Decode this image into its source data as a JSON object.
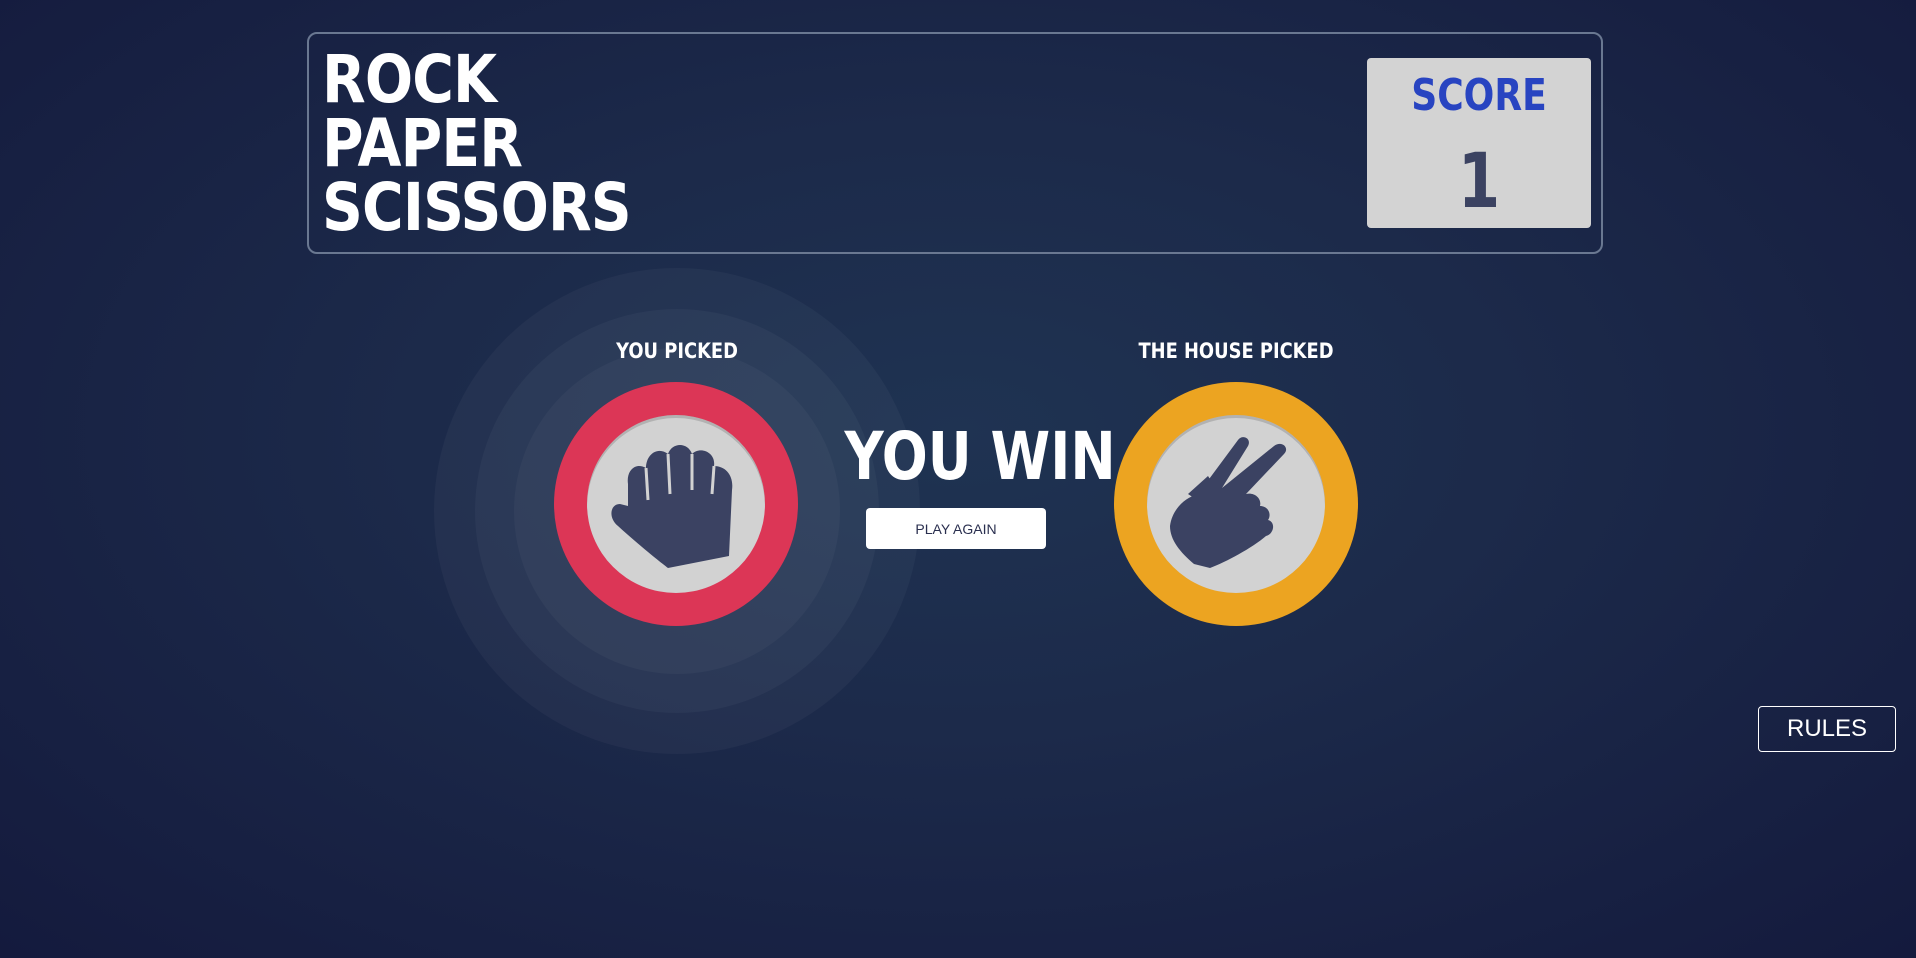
{
  "header": {
    "title_lines": [
      "ROCK",
      "PAPER",
      "SCISSORS"
    ],
    "score_label": "SCORE",
    "score_value": "1"
  },
  "game": {
    "player_label": "YOU PICKED",
    "house_label": "THE HOUSE PICKED",
    "player_pick": "rock",
    "house_pick": "scissors",
    "result": "YOU WIN",
    "play_again_label": "PLAY AGAIN"
  },
  "rules_label": "RULES",
  "colors": {
    "rock_ring": "#dc3656",
    "scissors_ring": "#eca421",
    "token_inner": "#d2d2d2",
    "icon": "#3b4262",
    "score_label": "#2844c1",
    "background": "#1c2a4a"
  },
  "icons": {
    "player_pick_icon": "rock-fist-icon",
    "house_pick_icon": "scissors-hand-icon"
  }
}
